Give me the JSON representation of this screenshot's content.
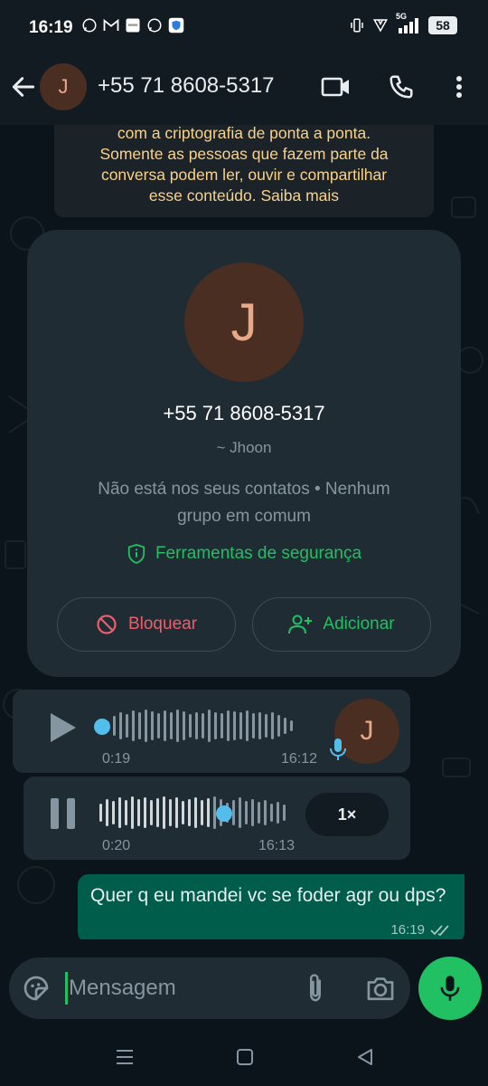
{
  "status_bar": {
    "time": "16:19",
    "network": "5G",
    "battery": "58"
  },
  "header": {
    "avatar_letter": "J",
    "title": "+55 71 8608-5317"
  },
  "encryption_notice": {
    "line1": "com a criptografia de ponta a ponta.",
    "line2": "Somente as pessoas que fazem parte da",
    "line3": "conversa podem ler, ouvir e compartilhar",
    "line4": "esse conteúdo. Saiba mais"
  },
  "contact_card": {
    "avatar_letter": "J",
    "phone": "+55 71 8608-5317",
    "name": "~ Jhoon",
    "info_line1": "Não está nos seus contatos • Nenhum",
    "info_line2": "grupo em comum",
    "security_label": "Ferramentas de segurança",
    "block_label": "Bloquear",
    "add_label": "Adicionar"
  },
  "audio_messages": [
    {
      "duration": "0:19",
      "time": "16:12",
      "avatar_letter": "J",
      "state": "paused",
      "progress": 0
    },
    {
      "duration": "0:20",
      "time": "16:13",
      "speed": "1×",
      "state": "playing",
      "progress": 0.6
    }
  ],
  "outgoing_message": {
    "text": "Quer q eu mandei vc se foder agr ou dps?",
    "time": "16:19",
    "status": "delivered"
  },
  "input_bar": {
    "placeholder": "Mensagem"
  },
  "colors": {
    "accent_green": "#21c063",
    "outgoing_bubble": "#005c4b",
    "incoming_bubble": "#1f2c33",
    "block_red": "#f15c6d",
    "notice_yellow": "#f8d28a",
    "audio_dot": "#53bdeb"
  }
}
